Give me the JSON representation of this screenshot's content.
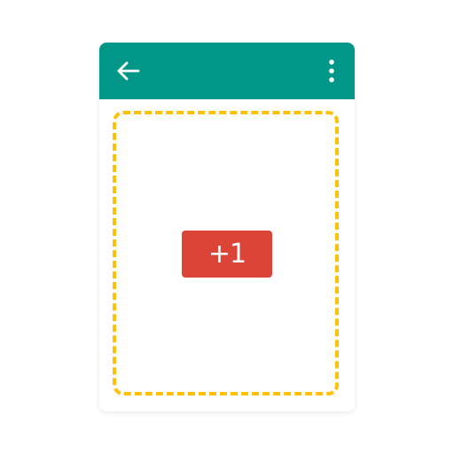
{
  "colors": {
    "app_bar": "#009688",
    "drop_zone_border": "#FFC107",
    "plus_one_button": "#DB4437",
    "icon": "#FFFFFF"
  },
  "app_bar": {
    "back_icon": "arrow-back-icon",
    "more_icon": "more-vert-icon"
  },
  "content": {
    "button_label": "+1"
  }
}
